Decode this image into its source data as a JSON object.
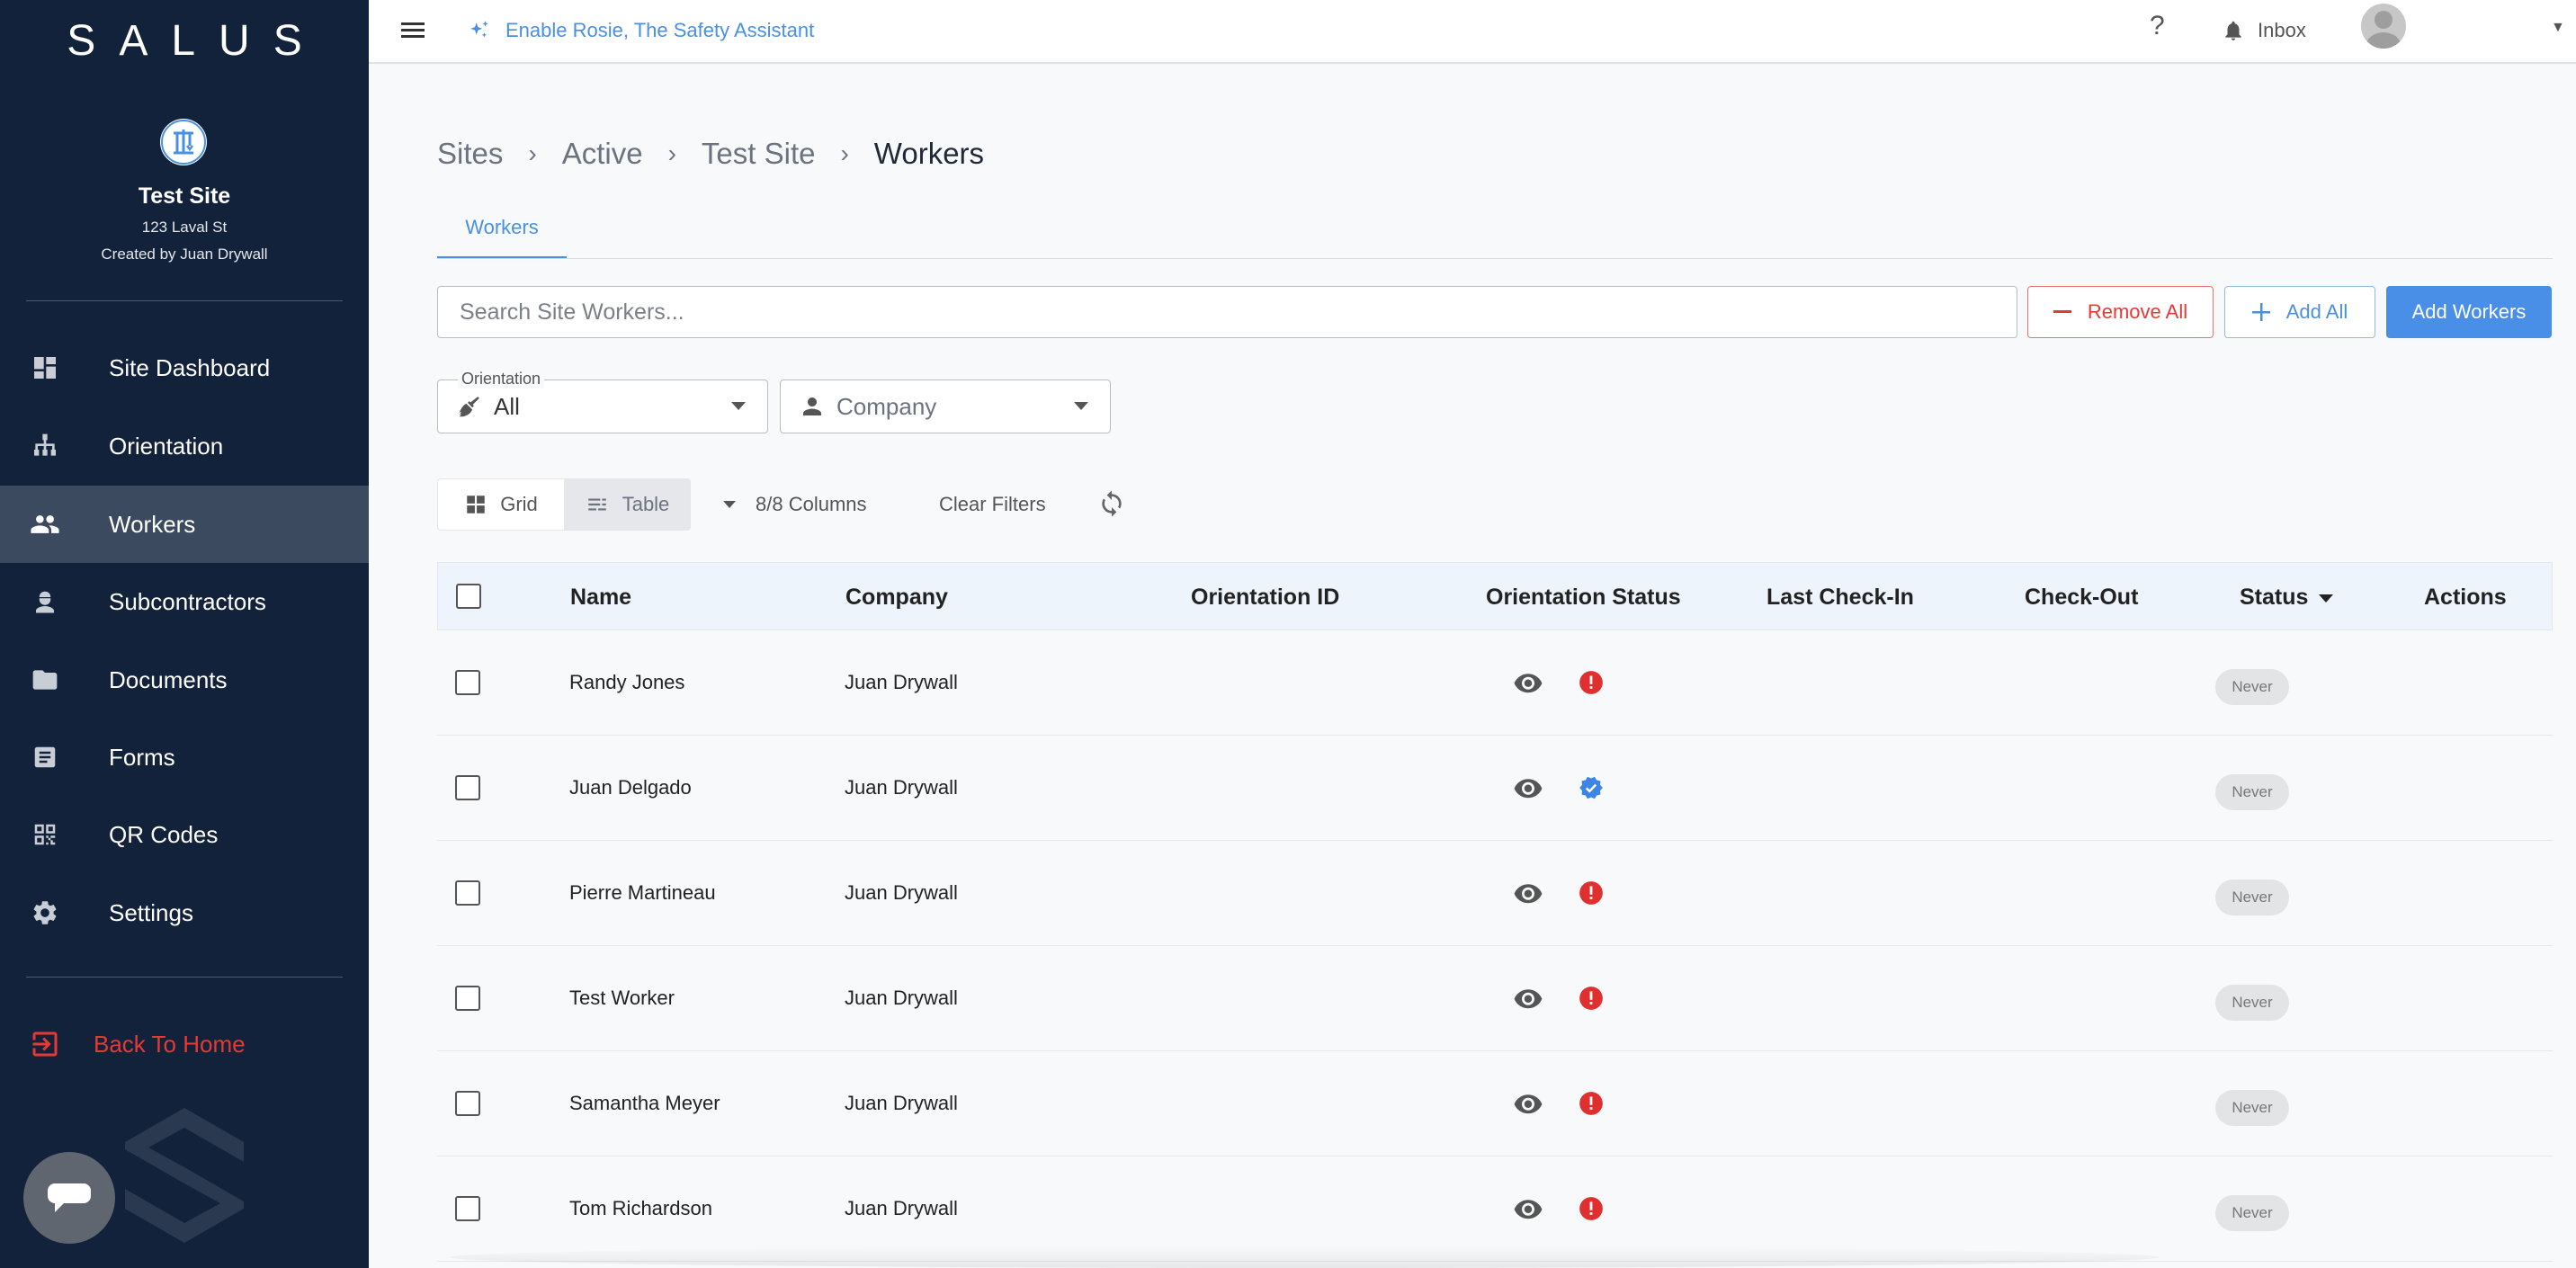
{
  "sidebar": {
    "brand": "SALUS",
    "site": {
      "name": "Test Site",
      "address": "123 Laval St",
      "created_by": "Created by Juan Drywall"
    },
    "items": [
      {
        "label": "Site Dashboard",
        "icon": "dashboard-icon"
      },
      {
        "label": "Orientation",
        "icon": "hierarchy-icon"
      },
      {
        "label": "Workers",
        "icon": "people-icon",
        "active": true
      },
      {
        "label": "Subcontractors",
        "icon": "hard-hat-worker-icon"
      },
      {
        "label": "Documents",
        "icon": "folder-icon"
      },
      {
        "label": "Forms",
        "icon": "form-icon"
      },
      {
        "label": "QR Codes",
        "icon": "qr-code-icon"
      },
      {
        "label": "Settings",
        "icon": "gear-icon"
      }
    ],
    "back_home": "Back To Home"
  },
  "topbar": {
    "assistant_label": "Enable Rosie, The Safety Assistant",
    "help": "?",
    "inbox": "Inbox"
  },
  "breadcrumb": [
    "Sites",
    "Active",
    "Test Site",
    "Workers"
  ],
  "tabs": [
    "Workers"
  ],
  "search": {
    "placeholder": "Search Site Workers..."
  },
  "actions": {
    "remove_all": "Remove All",
    "add_all": "Add All",
    "add_workers": "Add Workers"
  },
  "filters": {
    "orientation": {
      "label": "Orientation",
      "value": "All"
    },
    "company": {
      "placeholder": "Company"
    }
  },
  "view": {
    "grid": "Grid",
    "table": "Table",
    "columns": "8/8 Columns",
    "clear_filters": "Clear Filters"
  },
  "table": {
    "columns": [
      "Name",
      "Company",
      "Orientation ID",
      "Orientation Status",
      "Last Check-In",
      "Check-Out",
      "Status",
      "Actions"
    ],
    "rows": [
      {
        "name": "Randy Jones",
        "company": "Juan Drywall",
        "orientation_status": "incomplete",
        "status": "Never"
      },
      {
        "name": "Juan Delgado",
        "company": "Juan Drywall",
        "orientation_status": "verified",
        "status": "Never"
      },
      {
        "name": "Pierre Martineau",
        "company": "Juan Drywall",
        "orientation_status": "incomplete",
        "status": "Never"
      },
      {
        "name": "Test Worker",
        "company": "Juan Drywall",
        "orientation_status": "incomplete",
        "status": "Never"
      },
      {
        "name": "Samantha Meyer",
        "company": "Juan Drywall",
        "orientation_status": "incomplete",
        "status": "Never"
      },
      {
        "name": "Tom Richardson",
        "company": "Juan Drywall",
        "orientation_status": "incomplete",
        "status": "Never"
      }
    ]
  },
  "colors": {
    "sidebar": "#12223a",
    "accent": "#4a90e2",
    "danger": "#e53935",
    "verified": "#3d84e8"
  }
}
